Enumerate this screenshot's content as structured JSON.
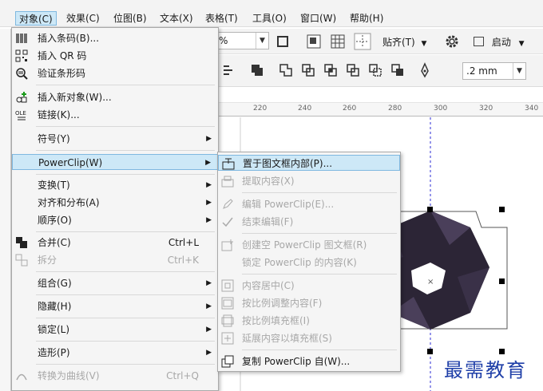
{
  "menubar": {
    "items": [
      "对象(C)",
      "效果(C)",
      "位图(B)",
      "文本(X)",
      "表格(T)",
      "工具(O)",
      "窗口(W)",
      "帮助(H)"
    ]
  },
  "toolbar1": {
    "zoom_value": "%",
    "snap_label": "贴齐(T)",
    "launch_label": "启动"
  },
  "toolbar2": {
    "outline_width": ".2 mm"
  },
  "ruler": {
    "ticks": [
      "220",
      "240",
      "260",
      "280",
      "300",
      "320",
      "340"
    ]
  },
  "object_menu": {
    "items": [
      {
        "label": "插入条码(B)...",
        "icon": "barcode-icon"
      },
      {
        "label": "插入 QR 码",
        "icon": "qr-code-icon"
      },
      {
        "label": "验证条形码",
        "icon": "verify-barcode-icon"
      },
      {
        "label": "插入新对象(W)...",
        "icon": "insert-object-icon"
      },
      {
        "label": "链接(K)...",
        "icon": "link-icon"
      },
      {
        "label": "符号(Y)"
      },
      {
        "label": "PowerClip(W)"
      },
      {
        "label": "变换(T)"
      },
      {
        "label": "对齐和分布(A)"
      },
      {
        "label": "顺序(O)"
      },
      {
        "label": "合并(C)",
        "shortcut": "Ctrl+L",
        "icon": "combine-icon"
      },
      {
        "label": "拆分",
        "shortcut": "Ctrl+K",
        "icon": "break-apart-icon"
      },
      {
        "label": "组合(G)"
      },
      {
        "label": "隐藏(H)"
      },
      {
        "label": "锁定(L)"
      },
      {
        "label": "造形(P)"
      },
      {
        "label": "转换为曲线(V)",
        "shortcut": "Ctrl+Q"
      }
    ]
  },
  "powerclip_menu": {
    "items": [
      {
        "label": "置于图文框内部(P)..."
      },
      {
        "label": "提取内容(X)"
      },
      {
        "label": "编辑 PowerClip(E)..."
      },
      {
        "label": "结束编辑(F)"
      },
      {
        "label": "创建空 PowerClip 图文框(R)"
      },
      {
        "label": "锁定 PowerClip 的内容(K)"
      },
      {
        "label": "内容居中(C)"
      },
      {
        "label": "按比例调整内容(F)"
      },
      {
        "label": "按比例填充框(I)"
      },
      {
        "label": "延展内容以填充框(S)"
      },
      {
        "label": "复制 PowerClip 自(W)..."
      }
    ]
  },
  "watermark": "最需教育",
  "colors": {
    "highlight": "#cde8f7",
    "guide": "#2b2bd6",
    "shape": "#2c2536"
  }
}
